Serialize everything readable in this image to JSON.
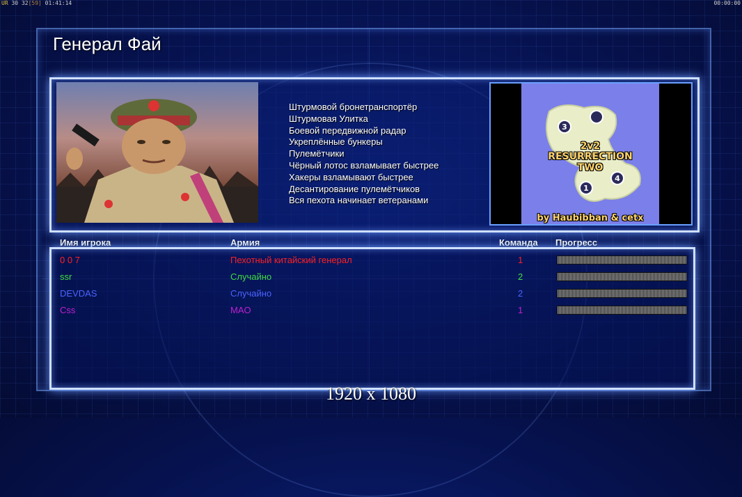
{
  "topbar": {
    "left_prefix": "UR",
    "left_fps": "30",
    "left_val": "32",
    "left_bracket": "[59]",
    "left_time": "01:41:14",
    "right_time": "00:00:00"
  },
  "general": {
    "title": "Генерал Фай",
    "features": [
      "Штурмовой бронетранспортёр",
      "Штурмовая Улитка",
      "Боевой передвижной радар",
      "Укреплённые бункеры",
      "Пулемётчики",
      "Чёрный лотос взламывает быстрее",
      "Хакеры взламывают быстрее",
      "Десантирование пулемётчиков",
      "Вся пехота начинает ветеранами"
    ]
  },
  "map": {
    "title_line1": "2v2",
    "title_line2": "RESURRECTION",
    "title_line3": "TWO",
    "credit": "by Haubibban & cetx",
    "slots": [
      "3",
      "1",
      "4"
    ],
    "water_color": "#7b7fe9",
    "land_color": "#e9edc8"
  },
  "columns": {
    "name": "Имя игрока",
    "army": "Армия",
    "team": "Команда",
    "progress": "Прогресс"
  },
  "players": [
    {
      "name": "0 0 7",
      "army": "Пехотный китайский генерал",
      "team": "1",
      "color": "#ff2020",
      "progress": 0.0
    },
    {
      "name": "ssr",
      "army": "Случайно",
      "team": "2",
      "color": "#3fdc3f",
      "progress": 0.0
    },
    {
      "name": "DEVDAS",
      "army": "Случайно",
      "team": "2",
      "color": "#4a64ff",
      "progress": 0.0
    },
    {
      "name": "Css",
      "army": "MAO",
      "team": "1",
      "color": "#c020d0",
      "progress": 0.0
    }
  ],
  "footer": {
    "resolution": "1920 x 1080"
  }
}
